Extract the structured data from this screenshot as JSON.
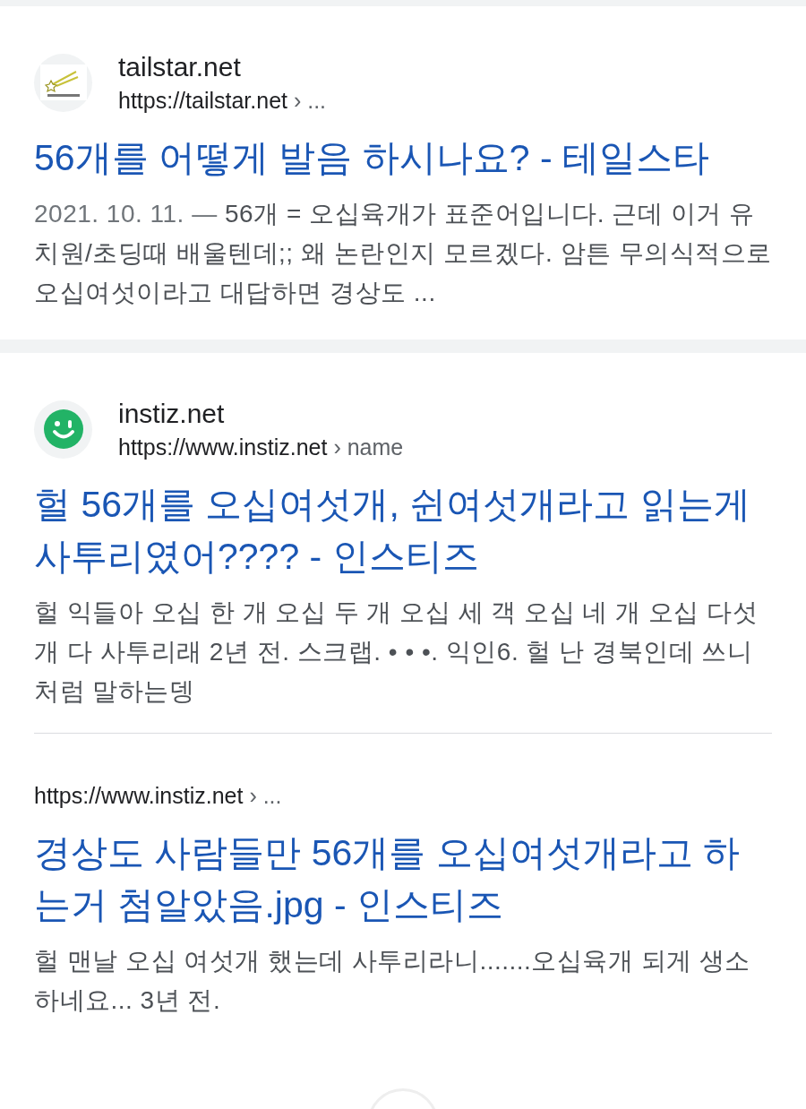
{
  "results": [
    {
      "kind": "card",
      "site_name": "tailstar.net",
      "url": "https://tailstar.net",
      "breadcrumb": "› ...",
      "title": "56개를 어떻게 발음 하시나요? - 테일스타",
      "date": "2021. 10. 11. — ",
      "snippet": "56개 = 오십육개가 표준어입니다. 근데 이거 유치원/초딩때 배울텐데;; 왜 논란인지 모르겠다. 암튼 무의식적으로 오십여섯이라고 대답하면 경상도 ..."
    },
    {
      "kind": "card",
      "site_name": "instiz.net",
      "url": "https://www.instiz.net",
      "breadcrumb": "› name",
      "title": "헐 56개를 오십여섯개, 쉰여섯개라고 읽는게 사투리였어???? - 인스티즈",
      "snippet": "헐 익들아 오십 한 개 오십 두 개 오십 세 객 오십 네 개 오십 다섯 개 다 사투리래 2년 전. 스크랩. • • •. 익인6. 헐 난 경북인데 쓰니처럼 말하는뎅"
    },
    {
      "kind": "sub",
      "url": "https://www.instiz.net",
      "breadcrumb": "› ...",
      "title": "경상도 사람들만 56개를 오십여섯개라고 하는거 첨알았음.jpg - 인스티즈",
      "snippet": "헐 맨날 오십 여섯개 했는데 사투리라니.......오십육개 되게 생소하네요... 3년 전."
    }
  ]
}
